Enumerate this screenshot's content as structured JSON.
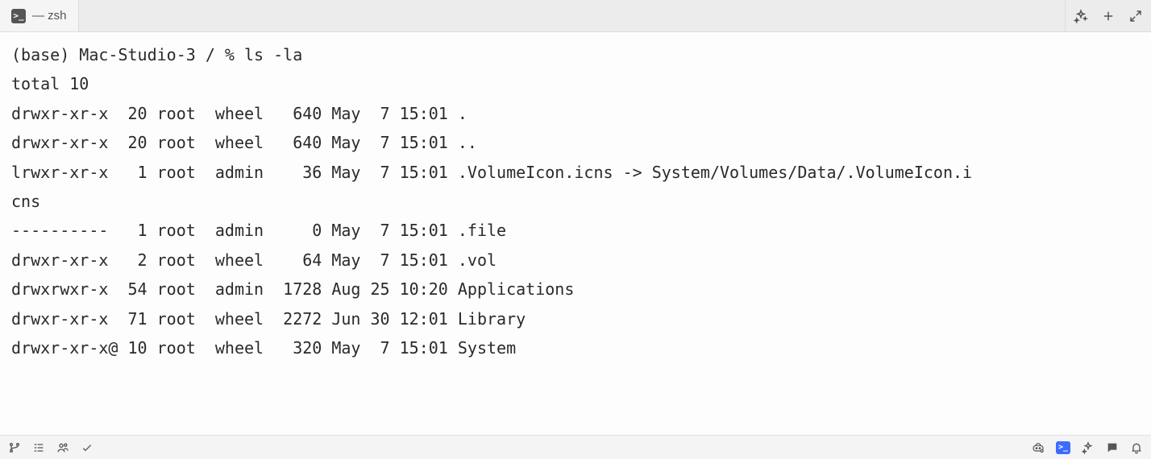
{
  "tab": {
    "icon": "terminal-icon",
    "title": "— zsh"
  },
  "actions": {
    "sparkle": "sparkle-icon",
    "plus": "plus-icon",
    "expand": "expand-icon"
  },
  "prompt": {
    "env": "(base)",
    "host": "Mac-Studio-3",
    "cwd": "/",
    "sep": "%",
    "cmd": "ls -la"
  },
  "output": {
    "total_line": "total 10",
    "rows": [
      {
        "perm": "drwxr-xr-x ",
        "links": "20",
        "owner": "root",
        "group": "wheel",
        "size": "640",
        "month": "May",
        "day": " 7",
        "time": "15:01",
        "name": "."
      },
      {
        "perm": "drwxr-xr-x ",
        "links": "20",
        "owner": "root",
        "group": "wheel",
        "size": "640",
        "month": "May",
        "day": " 7",
        "time": "15:01",
        "name": ".."
      },
      {
        "perm": "lrwxr-xr-x ",
        "links": " 1",
        "owner": "root",
        "group": "admin",
        "size": "36",
        "month": "May",
        "day": " 7",
        "time": "15:01",
        "name": ".VolumeIcon.icns -> System/Volumes/Data/.VolumeIcon.i",
        "wrap": "cns"
      },
      {
        "perm": "---------- ",
        "links": " 1",
        "owner": "root",
        "group": "admin",
        "size": "0",
        "month": "May",
        "day": " 7",
        "time": "15:01",
        "name": ".file"
      },
      {
        "perm": "drwxr-xr-x ",
        "links": " 2",
        "owner": "root",
        "group": "wheel",
        "size": "64",
        "month": "May",
        "day": " 7",
        "time": "15:01",
        "name": ".vol"
      },
      {
        "perm": "drwxrwxr-x ",
        "links": "54",
        "owner": "root",
        "group": "admin",
        "size": "1728",
        "month": "Aug",
        "day": "25",
        "time": "10:20",
        "name": "Applications"
      },
      {
        "perm": "drwxr-xr-x ",
        "links": "71",
        "owner": "root",
        "group": "wheel",
        "size": "2272",
        "month": "Jun",
        "day": "30",
        "time": "12:01",
        "name": "Library"
      },
      {
        "perm": "drwxr-xr-x@",
        "links": "10",
        "owner": "root",
        "group": "wheel",
        "size": "320",
        "month": "May",
        "day": " 7",
        "time": "15:01",
        "name": "System"
      }
    ]
  },
  "statusbar": {
    "left_icons": [
      "branch-icon",
      "outline-icon",
      "accounts-icon",
      "check-icon"
    ],
    "right_icons": [
      "copilot-icon",
      "terminal-badge-icon",
      "sparkle-icon",
      "chat-icon",
      "bell-icon"
    ]
  }
}
